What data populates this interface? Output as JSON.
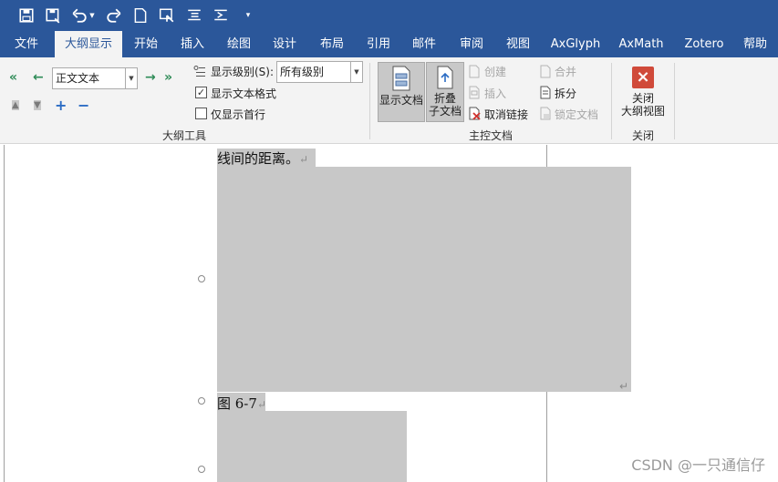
{
  "qat": {
    "icons": [
      "save-icon",
      "save-as-icon",
      "undo-icon",
      "redo-icon",
      "new-doc-icon",
      "touch-mode-icon",
      "outline-icon",
      "outline2-icon",
      "customize-icon"
    ]
  },
  "tabs": [
    {
      "label": "文件",
      "active": false
    },
    {
      "label": "大纲显示",
      "active": true
    },
    {
      "label": "开始",
      "active": false
    },
    {
      "label": "插入",
      "active": false
    },
    {
      "label": "绘图",
      "active": false
    },
    {
      "label": "设计",
      "active": false
    },
    {
      "label": "布局",
      "active": false
    },
    {
      "label": "引用",
      "active": false
    },
    {
      "label": "邮件",
      "active": false
    },
    {
      "label": "审阅",
      "active": false
    },
    {
      "label": "视图",
      "active": false
    },
    {
      "label": "AxGlyph",
      "active": false
    },
    {
      "label": "AxMath",
      "active": false
    },
    {
      "label": "Zotero",
      "active": false
    },
    {
      "label": "帮助",
      "active": false
    }
  ],
  "outline_tools": {
    "group_label": "大纲工具",
    "level_value": "正文文本",
    "show_level_label": "显示级别(S):",
    "show_level_value": "所有级别",
    "show_text_format": "显示文本格式",
    "show_text_format_checked": true,
    "show_first_line": "仅显示首行",
    "show_first_line_checked": false
  },
  "master_doc": {
    "group_label": "主控文档",
    "show_document": "显示文档",
    "collapse_line1": "折叠",
    "collapse_line2": "子文档",
    "create": "创建",
    "insert": "插入",
    "unlink": "取消链接",
    "merge": "合并",
    "split": "拆分",
    "lock": "锁定文档"
  },
  "close_group": {
    "group_label": "关闭",
    "close_line1": "关闭",
    "close_line2": "大纲视图"
  },
  "document": {
    "text1": "线间的距离。",
    "caption": "图 6-7",
    "para_mark": "↵"
  },
  "watermark": "CSDN @一只通信仔",
  "colors": {
    "ribbon_blue": "#2b579a",
    "ribbon_bg": "#f3f3f3",
    "close_red": "#d04a3a"
  }
}
